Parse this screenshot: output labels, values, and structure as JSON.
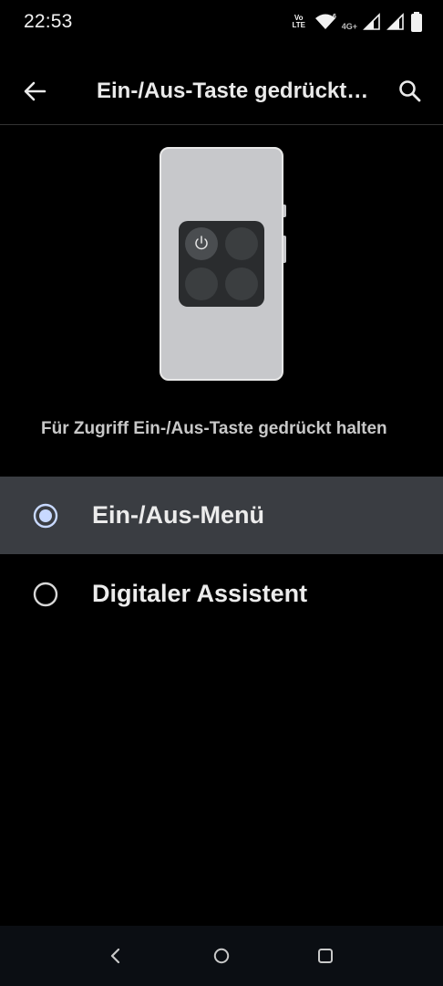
{
  "status_bar": {
    "time": "22:53",
    "volte_top": "Vo",
    "volte_bottom": "LTE",
    "network_label": "4G+",
    "icons": [
      "volte-icon",
      "wifi-icon",
      "signal-icon",
      "signal-icon",
      "battery-icon"
    ]
  },
  "app_bar": {
    "title": "Ein-/Aus-Taste gedrückt halten",
    "back_icon": "arrow-back-icon",
    "search_icon": "search-icon"
  },
  "illustration": {
    "power_icon": "power-icon"
  },
  "description": "Für Zugriff Ein-/Aus-Taste gedrückt halten",
  "options": [
    {
      "label": "Ein-/Aus-Menü",
      "selected": true
    },
    {
      "label": "Digitaler Assistent",
      "selected": false
    }
  ],
  "nav_bar": {
    "icons": [
      "back-icon",
      "home-icon",
      "recents-icon"
    ]
  },
  "colors": {
    "background": "#000000",
    "selected_row": "#3a3d42",
    "radio_accent": "#c8d9ff",
    "phone_body": "#c7c8cb",
    "panel": "#2a2c2e"
  }
}
